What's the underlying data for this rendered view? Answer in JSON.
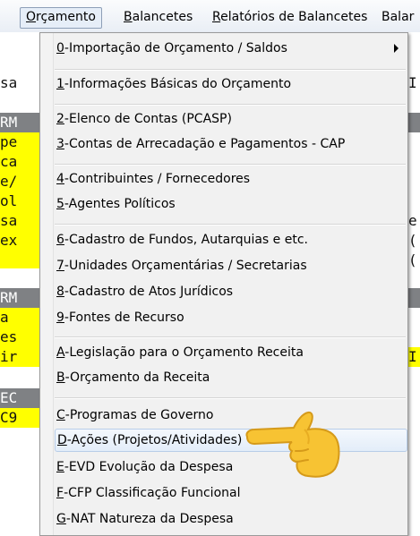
{
  "menubar": {
    "items": [
      {
        "hot": "O",
        "rest": "rçamento",
        "active": true
      },
      {
        "hot": "B",
        "rest": "alancetes",
        "active": false
      },
      {
        "hot": "R",
        "rest": "elatórios de Balancetes",
        "active": false
      },
      {
        "hot": "",
        "rest": "Balar",
        "active": false
      }
    ]
  },
  "background": {
    "left_rows": [
      "sa",
      "RM",
      "pe",
      "ca",
      "e/",
      "ol",
      "sa",
      "ex",
      "RM",
      "a",
      "es",
      "ir",
      "EC",
      "C9"
    ],
    "right_rows": [
      "I",
      "e",
      "(",
      "(",
      "I"
    ]
  },
  "menu": {
    "items": [
      {
        "hot": "0",
        "rest": "-Importação de Orçamento / Saldos",
        "submenu": true
      },
      {
        "hot": "1",
        "rest": "-Informações Básicas do Orçamento"
      },
      {
        "hot": "2",
        "rest": "-Elenco de Contas (PCASP)"
      },
      {
        "hot": "3",
        "rest": "-Contas de Arrecadação e Pagamentos - CAP"
      },
      {
        "hot": "4",
        "rest": "-Contribuintes / Fornecedores"
      },
      {
        "hot": "5",
        "rest": "-Agentes Políticos"
      },
      {
        "hot": "6",
        "rest": "-Cadastro de Fundos, Autarquias e etc."
      },
      {
        "hot": "7",
        "rest": "-Unidades Orçamentárias / Secretarias"
      },
      {
        "hot": "8",
        "rest": "-Cadastro de Atos Jurídicos"
      },
      {
        "hot": "9",
        "rest": "-Fontes de Recurso"
      },
      {
        "hot": "A",
        "rest": "-Legislação para o Orçamento Receita"
      },
      {
        "hot": "B",
        "rest": "-Orçamento da Receita"
      },
      {
        "hot": "C",
        "rest": "-Programas de Governo"
      },
      {
        "hot": "D",
        "rest": "-Ações (Projetos/Atividades)",
        "highlighted": true
      },
      {
        "hot": "E",
        "rest": "-EVD Evolução da Despesa"
      },
      {
        "hot": "F",
        "rest": "-CFP Classificação Funcional"
      },
      {
        "hot": "G",
        "rest": "-NAT Natureza da Despesa"
      }
    ]
  },
  "pointer": {
    "icon": "pointing-hand-icon",
    "color": "#f7c333"
  },
  "colors": {
    "yellow": "#ffff00",
    "gray_strip": "#7f8184",
    "highlight_border": "#b8cde8"
  }
}
